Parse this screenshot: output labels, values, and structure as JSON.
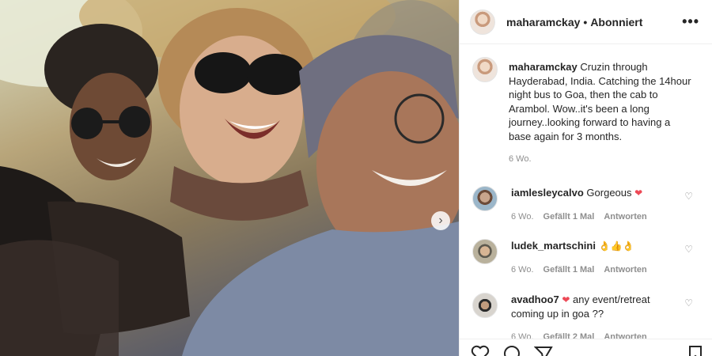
{
  "header": {
    "username": "maharamckay",
    "separator": "•",
    "follow_status": "Abonniert",
    "more_icon": "more-dots-icon"
  },
  "caption": {
    "username": "maharamckay",
    "text": "Cruzin through Hayderabad, India. Catching the 14hour night bus to Goa, then the cab to Arambol. Wow..it's been a long journey..looking forward to having a base again for 3 months.",
    "time": "6 Wo."
  },
  "comments": [
    {
      "username": "iamlesleycalvo",
      "text": "Gorgeous",
      "emoji": "❤",
      "time": "6 Wo.",
      "likes": "Gefällt 1 Mal",
      "reply": "Antworten"
    },
    {
      "username": "ludek_martschini",
      "text": "👌👍👌",
      "time": "6 Wo.",
      "likes": "Gefällt 1 Mal",
      "reply": "Antworten"
    },
    {
      "username": "avadhoo7",
      "emoji": "❤",
      "text": "any event/retreat coming up in goa ??",
      "time": "6 Wo.",
      "likes": "Gefällt 2 Mal",
      "reply": "Antworten"
    }
  ],
  "photo": {
    "next_icon": "chevron-right-icon"
  },
  "colors": {
    "accent_red": "#ed4956",
    "muted": "#8e8e8e",
    "text": "#262626"
  }
}
